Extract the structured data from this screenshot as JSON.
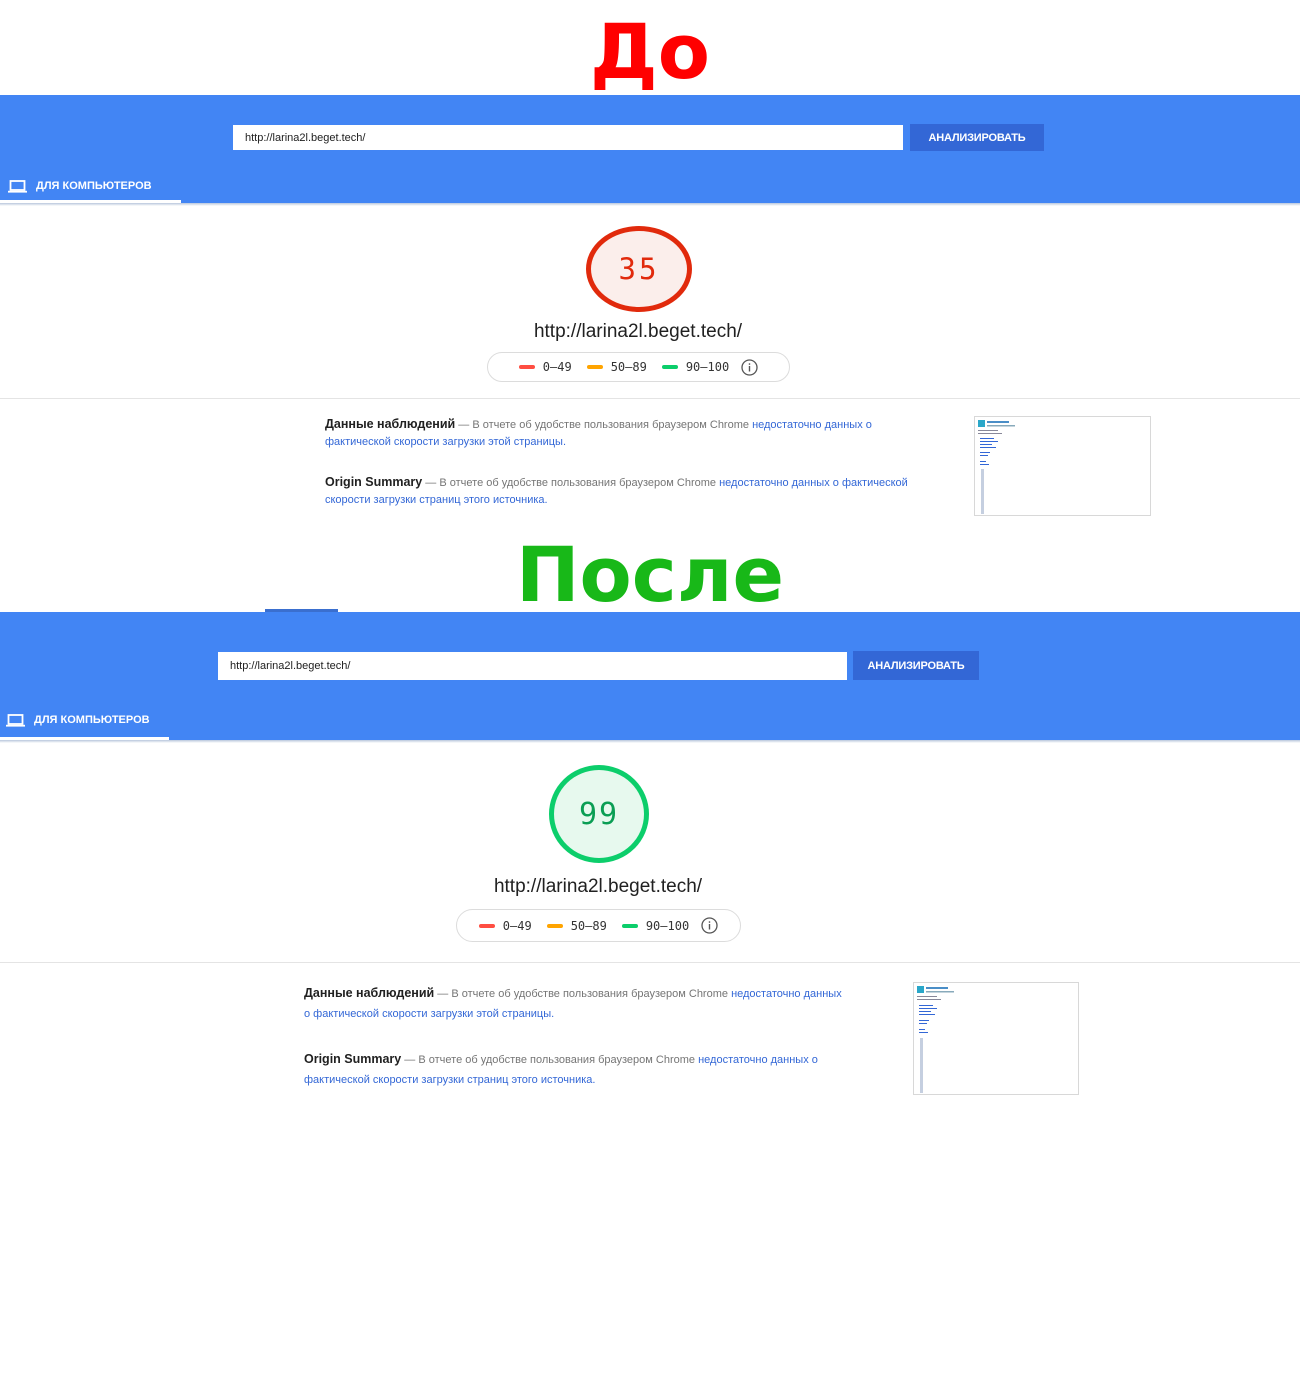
{
  "labels": {
    "before": "До",
    "after": "После"
  },
  "colors": {
    "bar_blue": "#4285f4",
    "button_blue": "#3367d6",
    "fail_red": "#ff4e42",
    "average_orange": "#ffa400",
    "pass_green": "#0cce6b",
    "link_blue": "#3367d6",
    "before_label": "#ff0000",
    "after_label": "#18b818"
  },
  "before": {
    "search": {
      "url_value": "http://larina2l.beget.tech/",
      "button_label": "АНАЛИЗИРОВАТЬ"
    },
    "tab": {
      "label": "ДЛЯ КОМПЬЮТЕРОВ",
      "icon": "laptop-icon"
    },
    "score": {
      "value": "35",
      "rating": "fail"
    },
    "tested_url": "http://larina2l.beget.tech/",
    "legend": {
      "fail": "0–49",
      "average": "50–89",
      "pass": "90–100",
      "info_icon": "info-icon"
    },
    "field_data": {
      "title": "Данные наблюдений",
      "text": " — В отчете об удобстве пользования браузером Chrome ",
      "link": "недостаточно данных о фактической скорости загрузки этой страницы."
    },
    "origin_summary": {
      "title": "Origin Summary",
      "text": " — В отчете об удобстве пользования браузером Chrome ",
      "link": "недостаточно данных о фактической скорости загрузки страниц этого источника."
    }
  },
  "after": {
    "search": {
      "url_value": "http://larina2l.beget.tech/",
      "button_label": "АНАЛИЗИРОВАТЬ"
    },
    "tab": {
      "label": "ДЛЯ КОМПЬЮТЕРОВ",
      "icon": "laptop-icon"
    },
    "score": {
      "value": "99",
      "rating": "pass"
    },
    "tested_url": "http://larina2l.beget.tech/",
    "legend": {
      "fail": "0–49",
      "average": "50–89",
      "pass": "90–100",
      "info_icon": "info-icon"
    },
    "field_data": {
      "title": "Данные наблюдений",
      "text": " — В отчете об удобстве пользования браузером Chrome ",
      "link": "недостаточно данных о фактической скорости загрузки этой страницы."
    },
    "origin_summary": {
      "title": "Origin Summary",
      "text": " — В отчете об удобстве пользования браузером Chrome ",
      "link": "недостаточно данных о фактической скорости загрузки страниц этого источника."
    }
  }
}
